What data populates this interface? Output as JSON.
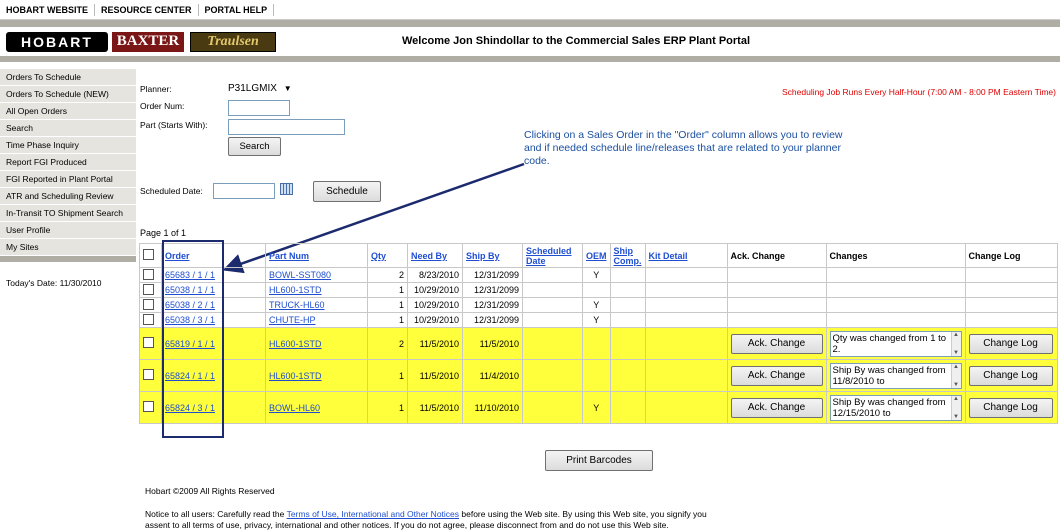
{
  "topnav": {
    "items": [
      "HOBART WEBSITE",
      "RESOURCE CENTER",
      "PORTAL HELP"
    ]
  },
  "banner": {
    "logos": [
      "HOBART",
      "BAXTER",
      "Traulsen"
    ],
    "welcome": "Welcome Jon Shindollar to the Commercial Sales ERP Plant Portal"
  },
  "sidebar": {
    "items": [
      "Orders To Schedule",
      "Orders To Schedule (NEW)",
      "All Open Orders",
      "Search",
      "Time Phase Inquiry",
      "Report FGI Produced",
      "FGI Reported in Plant Portal",
      "ATR and Scheduling Review",
      "In-Transit TO Shipment Search",
      "User Profile",
      "My Sites"
    ],
    "today": "Today's Date: 11/30/2010"
  },
  "form": {
    "planner_label": "Planner:",
    "planner_value": "P31LGMIX",
    "order_label": "Order Num:",
    "part_label": "Part (Starts With):",
    "search_btn": "Search",
    "sched_label": "Scheduled Date:",
    "schedule_btn": "Schedule"
  },
  "note": "Scheduling Job Runs Every Half-Hour (7:00 AM - 8:00 PM Eastern Time)",
  "callout": "Clicking on a Sales Order in the \"Order\" column allows you to review and if needed schedule line/releases that are related to your planner code.",
  "page_info": "Page 1 of 1",
  "table": {
    "headers": [
      "Order",
      "Part Num",
      "Qty",
      "Need By",
      "Ship By",
      "Scheduled Date",
      "OEM",
      "Ship Comp.",
      "Kit Detail",
      "Ack. Change",
      "Changes",
      "Change Log"
    ],
    "rows": [
      {
        "order": "65683 / 1 / 1",
        "part": "BOWL-SST080",
        "qty": "2",
        "need": "8/23/2010",
        "ship": "12/31/2099",
        "oem": "Y"
      },
      {
        "order": "65038 / 1 / 1",
        "part": "HL600-1STD",
        "qty": "1",
        "need": "10/29/2010",
        "ship": "12/31/2099",
        "oem": ""
      },
      {
        "order": "65038 / 2 / 1",
        "part": "TRUCK-HL60",
        "qty": "1",
        "need": "10/29/2010",
        "ship": "12/31/2099",
        "oem": "Y"
      },
      {
        "order": "65038 / 3 / 1",
        "part": "CHUTE-HP",
        "qty": "1",
        "need": "10/29/2010",
        "ship": "12/31/2099",
        "oem": "Y"
      }
    ],
    "hl_rows": [
      {
        "order": "65819 / 1 / 1",
        "part": "HL600-1STD",
        "qty": "2",
        "need": "11/5/2010",
        "ship": "11/5/2010",
        "oem": "",
        "change": "Qty was changed from 1 to 2.",
        "ack": "Ack. Change",
        "log": "Change Log"
      },
      {
        "order": "65824 / 1 / 1",
        "part": "HL600-1STD",
        "qty": "1",
        "need": "11/5/2010",
        "ship": "11/4/2010",
        "oem": "",
        "change": "Ship By was changed from 11/8/2010 to",
        "ack": "Ack. Change",
        "log": "Change Log"
      },
      {
        "order": "65824 / 3 / 1",
        "part": "BOWL-HL60",
        "qty": "1",
        "need": "11/5/2010",
        "ship": "11/10/2010",
        "oem": "Y",
        "change": "Ship By was changed from 12/15/2010 to",
        "ack": "Ack. Change",
        "log": "Change Log"
      }
    ]
  },
  "print_btn": "Print Barcodes",
  "footer": {
    "copyright": "Hobart ©2009 All Rights Reserved",
    "notice_pre": "Notice to all users: Carefully read the ",
    "notice_link": "Terms of Use, International and Other Notices",
    "notice_post": " before using the Web site. By using this Web site, you signify you",
    "notice_line2": "assent to all terms of use, privacy, international and other notices. If you do not agree, please disconnect from and do not use this Web site."
  }
}
